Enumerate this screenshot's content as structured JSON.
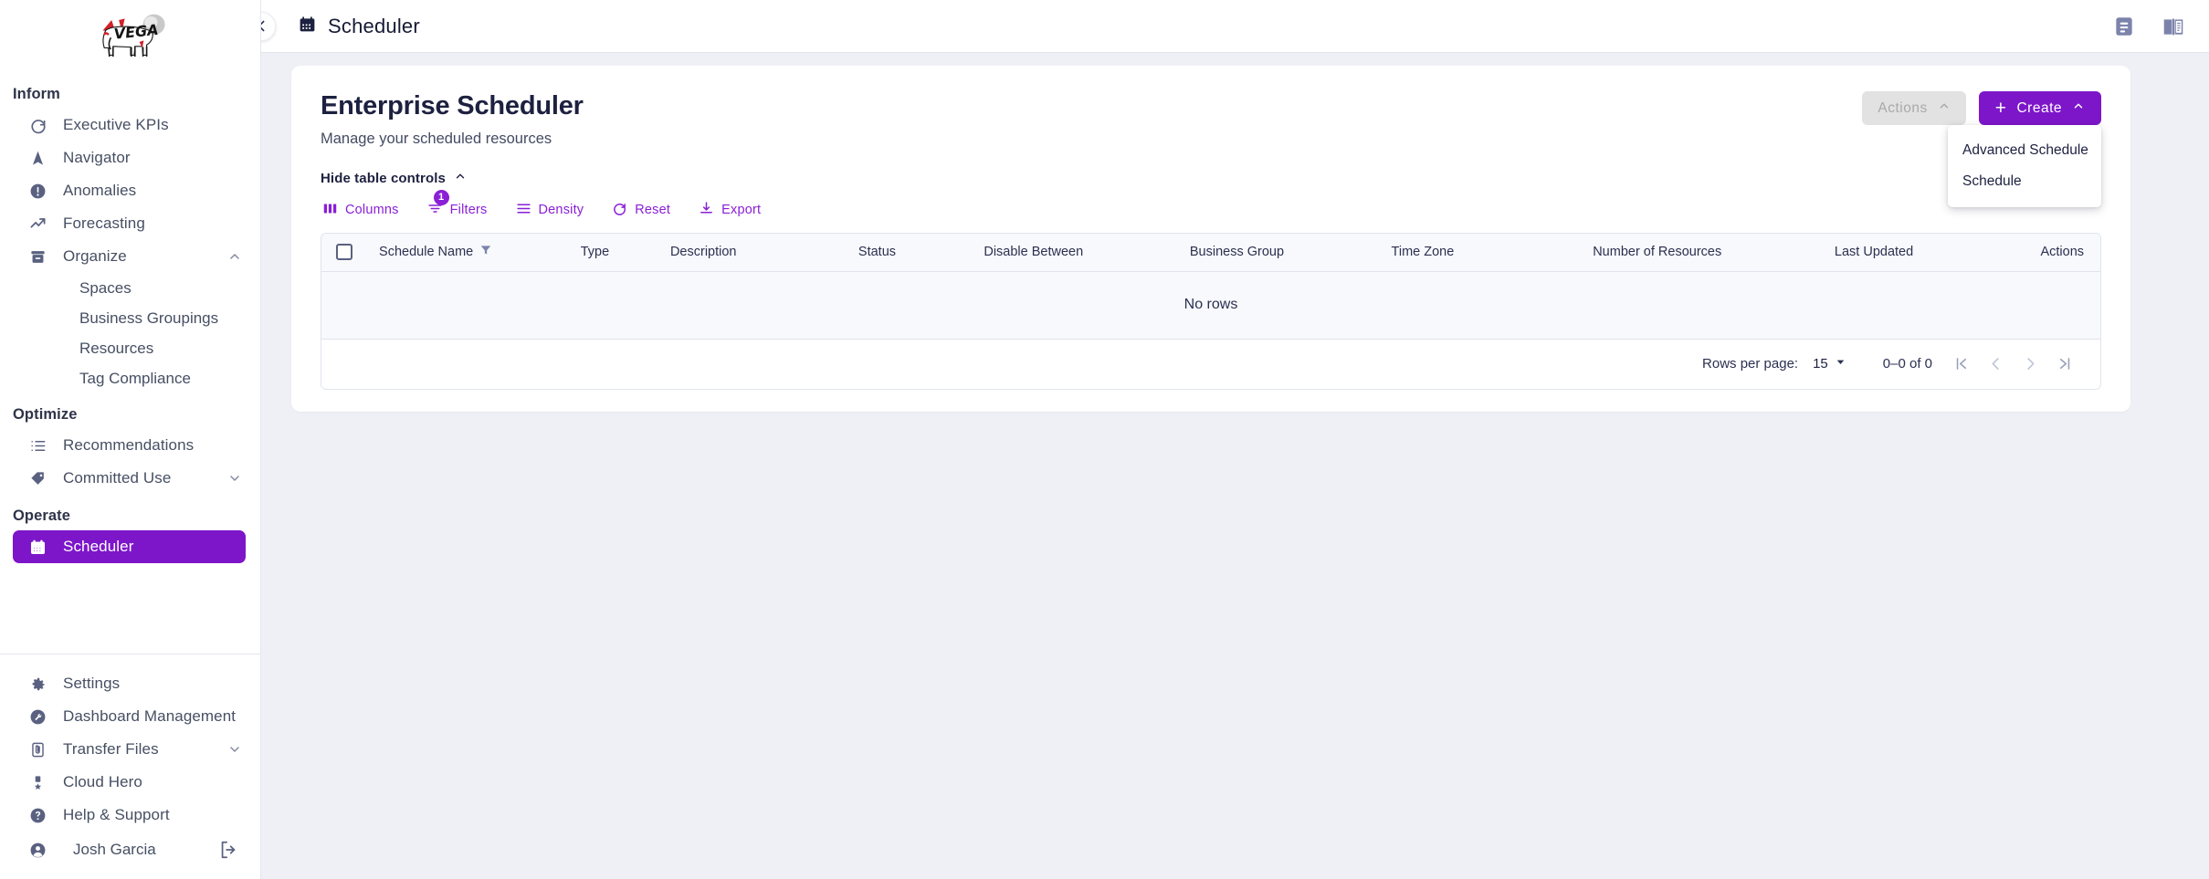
{
  "brand": {
    "logo_alt": "Vega",
    "accent": "#7d16c9",
    "accent_light": "#8a1fd6"
  },
  "sidebar": {
    "sections": [
      {
        "label": "Inform",
        "items": [
          {
            "label": "Executive KPIs",
            "icon": "gauge-icon"
          },
          {
            "label": "Navigator",
            "icon": "navigation-arrow-icon"
          },
          {
            "label": "Anomalies",
            "icon": "alert-circle-icon"
          },
          {
            "label": "Forecasting",
            "icon": "trending-up-icon"
          },
          {
            "label": "Organize",
            "icon": "archive-icon",
            "chevron": "chevron-up-icon",
            "expanded": true,
            "children": [
              {
                "label": "Spaces"
              },
              {
                "label": "Business Groupings"
              },
              {
                "label": "Resources"
              },
              {
                "label": "Tag Compliance"
              }
            ]
          }
        ]
      },
      {
        "label": "Optimize",
        "items": [
          {
            "label": "Recommendations",
            "icon": "list-icon"
          },
          {
            "label": "Committed Use",
            "icon": "tag-icon",
            "chevron": "chevron-down-icon"
          }
        ]
      },
      {
        "label": "Operate",
        "items": [
          {
            "label": "Scheduler",
            "icon": "calendar-icon",
            "active": true
          }
        ]
      }
    ],
    "footer_items": [
      {
        "label": "Settings",
        "icon": "gear-icon"
      },
      {
        "label": "Dashboard Management",
        "icon": "wrench-circle-icon"
      },
      {
        "label": "Transfer Files",
        "icon": "paperclip-doc-icon",
        "chevron": "chevron-down-icon"
      },
      {
        "label": "Cloud Hero",
        "icon": "medal-icon"
      },
      {
        "label": "Help & Support",
        "icon": "question-circle-icon"
      }
    ],
    "user": {
      "name": "Josh Garcia",
      "avatar_icon": "user-circle-icon",
      "logout_icon": "logout-icon"
    }
  },
  "topbar": {
    "back_icon": "chevron-left-icon",
    "title_icon": "calendar-icon",
    "title": "Scheduler",
    "icons": [
      {
        "name": "notes-icon"
      },
      {
        "name": "manual-book-icon"
      }
    ]
  },
  "page": {
    "title": "Enterprise Scheduler",
    "subtitle": "Manage your scheduled resources",
    "actions_label": "Actions",
    "actions_disabled": true,
    "create_label": "Create",
    "create_menu_open": true,
    "create_menu": [
      "Advanced Schedule",
      "Schedule"
    ]
  },
  "table_controls": {
    "toggle_label": "Hide table controls",
    "buttons": [
      {
        "label": "Columns",
        "icon": "columns-icon"
      },
      {
        "label": "Filters",
        "icon": "filter-lines-icon",
        "badge": "1"
      },
      {
        "label": "Density",
        "icon": "density-icon"
      },
      {
        "label": "Reset",
        "icon": "reset-icon"
      },
      {
        "label": "Export",
        "icon": "export-icon"
      }
    ]
  },
  "grid": {
    "columns": [
      {
        "label": "Schedule Name",
        "filtered": true
      },
      {
        "label": "Type"
      },
      {
        "label": "Description"
      },
      {
        "label": "Status"
      },
      {
        "label": "Disable Between"
      },
      {
        "label": "Business Group"
      },
      {
        "label": "Time Zone"
      },
      {
        "label": "Number of Resources"
      },
      {
        "label": "Last Updated"
      },
      {
        "label": "Actions"
      }
    ],
    "rows": [],
    "empty_text": "No rows",
    "footer": {
      "rows_per_page_label": "Rows per page:",
      "rows_per_page_value": "15",
      "range_text": "0–0 of 0",
      "first_icon": "page-first-icon",
      "prev_icon": "page-prev-icon",
      "next_icon": "page-next-icon",
      "last_icon": "page-last-icon"
    }
  }
}
